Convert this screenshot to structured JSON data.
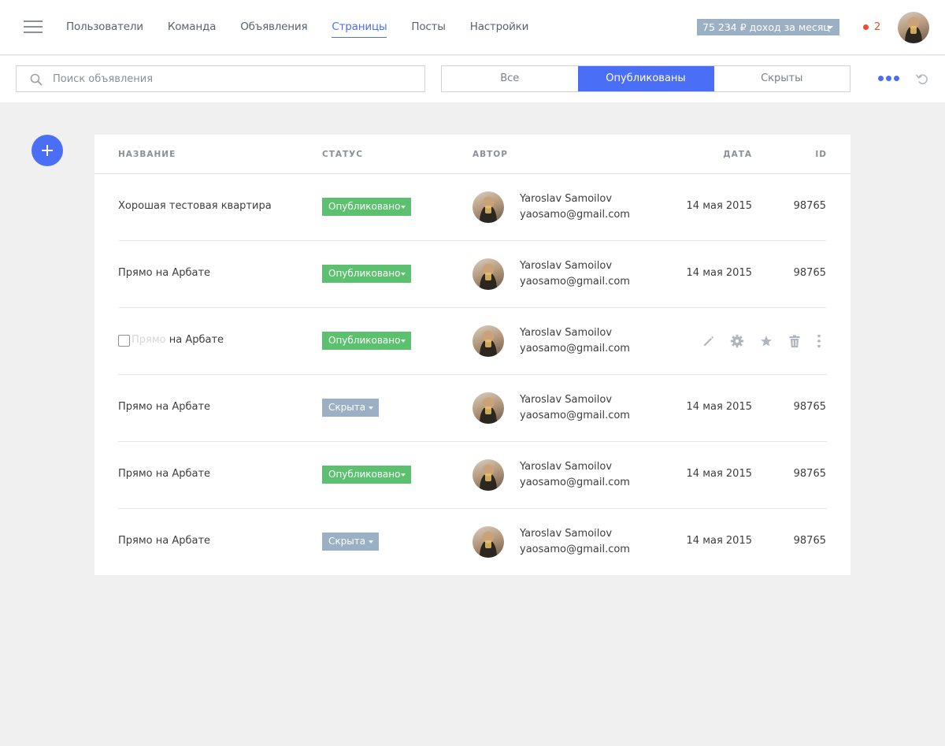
{
  "nav": {
    "items": [
      {
        "label": "Пользователи"
      },
      {
        "label": "Команда"
      },
      {
        "label": "Объявления"
      },
      {
        "label": "Страницы",
        "active": true
      },
      {
        "label": "Посты"
      },
      {
        "label": "Настройки"
      }
    ]
  },
  "income": {
    "label": "75 234 ₽ доход за месяц"
  },
  "notifications": {
    "count": "2"
  },
  "search": {
    "placeholder": "Поиск объявления",
    "value": ""
  },
  "filter": {
    "options": [
      "Все",
      "Опубликованы",
      "Скрыты"
    ],
    "selected": "Опубликованы"
  },
  "table": {
    "headers": {
      "name": "НАЗВАНИЕ",
      "status": "СТАТУС",
      "author": "АВТОР",
      "date": "ДАТА",
      "id": "ID"
    },
    "rows": [
      {
        "title": "Хорошая тестовая квартира",
        "status": "Опубликовано",
        "author_name": "Yaroslav Samoilov",
        "author_email": "yaosamo@gmail.com",
        "date": "14 мая 2015",
        "id": "98765"
      },
      {
        "title": "Прямо на Арбате",
        "status": "Опубликовано",
        "author_name": "Yaroslav Samoilov",
        "author_email": "yaosamo@gmail.com",
        "date": "14 мая 2015",
        "id": "98765"
      },
      {
        "title_ghost": "Прямо",
        "title_solid": "на Арбате",
        "status": "Опубликовано",
        "author_name": "Yaroslav Samoilov",
        "author_email": "yaosamo@gmail.com",
        "hover": true
      },
      {
        "title": "Прямо на Арбате",
        "status": "Скрыта",
        "author_name": "Yaroslav Samoilov",
        "author_email": "yaosamo@gmail.com",
        "date": "14 мая 2015",
        "id": "98765"
      },
      {
        "title": "Прямо на Арбате",
        "status": "Опубликовано",
        "author_name": "Yaroslav Samoilov",
        "author_email": "yaosamo@gmail.com",
        "date": "14 мая 2015",
        "id": "98765"
      },
      {
        "title": "Прямо на Арбате",
        "status": "Скрыта",
        "author_name": "Yaroslav Samoilov",
        "author_email": "yaosamo@gmail.com",
        "date": "14 мая 2015",
        "id": "98765"
      }
    ]
  },
  "row_actions": [
    "pencil-icon",
    "gear-icon",
    "star-icon",
    "trash-icon",
    "vertical-dots-icon"
  ],
  "colors": {
    "accent": "#4a6ef5",
    "published": "#5cc16f",
    "hidden": "#9bb0c4",
    "notification": "#f04b2f"
  }
}
